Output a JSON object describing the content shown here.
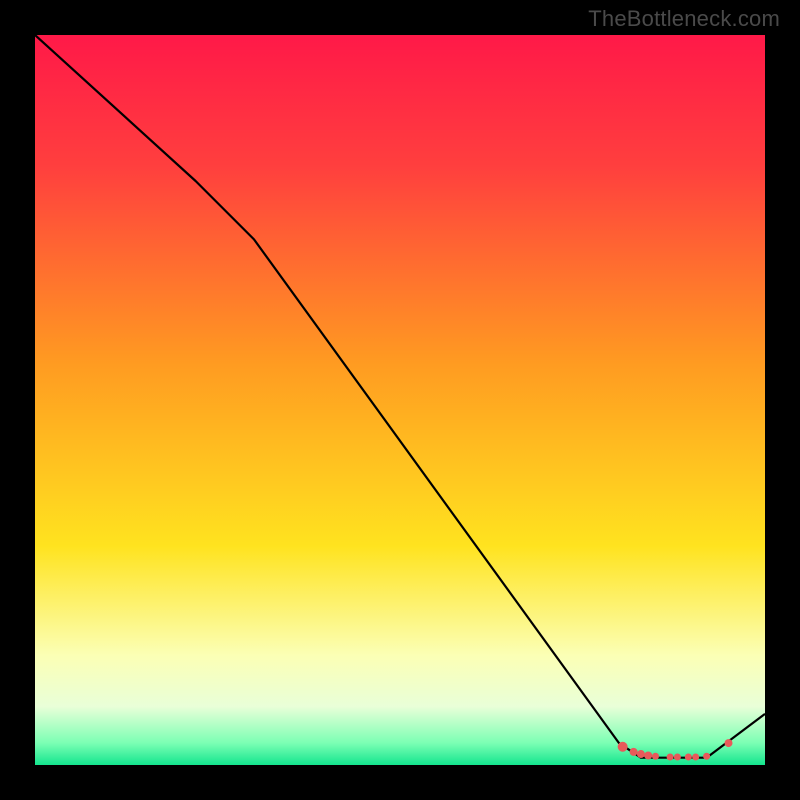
{
  "watermark": "TheBottleneck.com",
  "chart_data": {
    "type": "line",
    "title": "",
    "xlabel": "",
    "ylabel": "",
    "xlim": [
      0,
      100
    ],
    "ylim": [
      0,
      100
    ],
    "gradient_stops": [
      {
        "offset": 0,
        "color": "#ff1948"
      },
      {
        "offset": 18,
        "color": "#ff3f3e"
      },
      {
        "offset": 45,
        "color": "#ff9b21"
      },
      {
        "offset": 70,
        "color": "#ffe31f"
      },
      {
        "offset": 85,
        "color": "#fbffb5"
      },
      {
        "offset": 92,
        "color": "#e9ffd8"
      },
      {
        "offset": 97,
        "color": "#7bffb4"
      },
      {
        "offset": 100,
        "color": "#14e58e"
      }
    ],
    "curve": [
      {
        "x": 0,
        "y": 100
      },
      {
        "x": 22,
        "y": 80
      },
      {
        "x": 30,
        "y": 72
      },
      {
        "x": 80,
        "y": 3
      },
      {
        "x": 83,
        "y": 1
      },
      {
        "x": 92,
        "y": 1
      },
      {
        "x": 100,
        "y": 7
      }
    ],
    "markers": [
      {
        "x": 80.5,
        "y": 2.5,
        "r": 5
      },
      {
        "x": 82,
        "y": 1.8,
        "r": 4
      },
      {
        "x": 83,
        "y": 1.5,
        "r": 4
      },
      {
        "x": 84,
        "y": 1.3,
        "r": 4
      },
      {
        "x": 85,
        "y": 1.2,
        "r": 3.5
      },
      {
        "x": 87,
        "y": 1.1,
        "r": 3.5
      },
      {
        "x": 88,
        "y": 1.1,
        "r": 3.5
      },
      {
        "x": 89.5,
        "y": 1.1,
        "r": 3.5
      },
      {
        "x": 90.5,
        "y": 1.1,
        "r": 3.5
      },
      {
        "x": 92,
        "y": 1.2,
        "r": 3.5
      },
      {
        "x": 95,
        "y": 3.0,
        "r": 4
      }
    ],
    "line_color": "#000000",
    "marker_color": "#e85a5a"
  }
}
